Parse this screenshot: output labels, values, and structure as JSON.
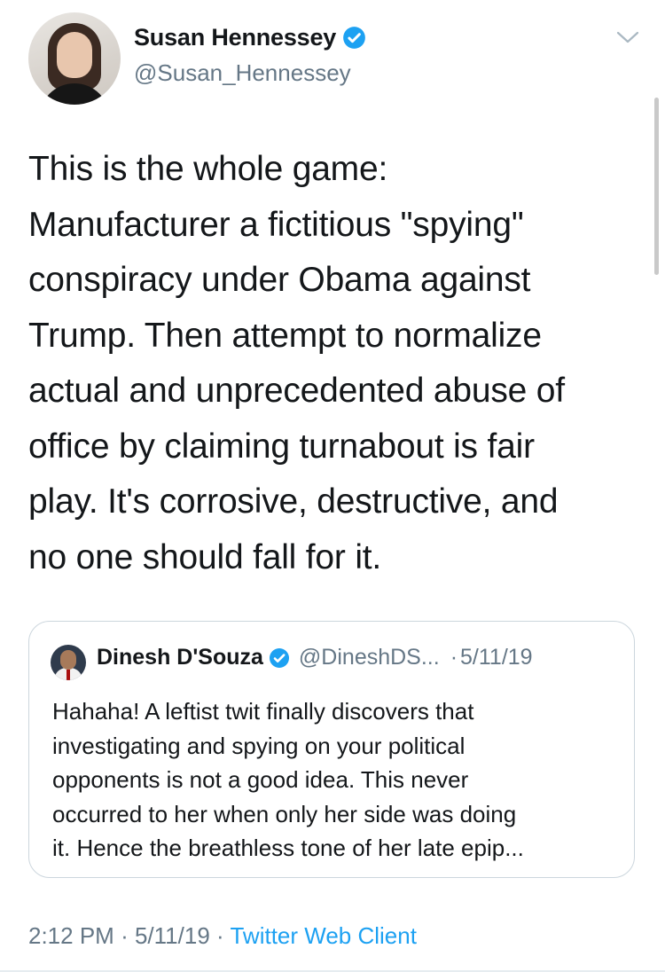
{
  "author": {
    "name": "Susan Hennessey",
    "handle": "@Susan_Hennessey",
    "verified": true
  },
  "tweet": {
    "text": "This is the whole game:\nManufacturer a fictitious \"spying\"\nconspiracy under Obama against\nTrump. Then attempt to normalize\nactual and unprecedented abuse of\noffice by claiming turnabout is fair\nplay. It's corrosive, destructive, and\nno one should fall for it."
  },
  "quoted_tweet": {
    "name": "Dinesh D'Souza",
    "handle": "@DineshDS...",
    "separator": "·",
    "date": "5/11/19",
    "verified": true,
    "text": "Hahaha! A leftist twit finally discovers that\ninvestigating and spying on your political\nopponents is not a good idea. This never\noccurred to her when only her side was doing\nit. Hence the breathless tone of her late epip..."
  },
  "meta": {
    "time": "2:12 PM",
    "sep1": "·",
    "date": "5/11/19",
    "sep2": "·",
    "source": "Twitter Web Client"
  },
  "icons": {
    "verified": "verified-badge-icon",
    "more": "chevron-down-icon"
  },
  "colors": {
    "accent": "#1da1f2",
    "text": "#14171a",
    "secondary": "#657786",
    "border": "#ccd6dd"
  }
}
